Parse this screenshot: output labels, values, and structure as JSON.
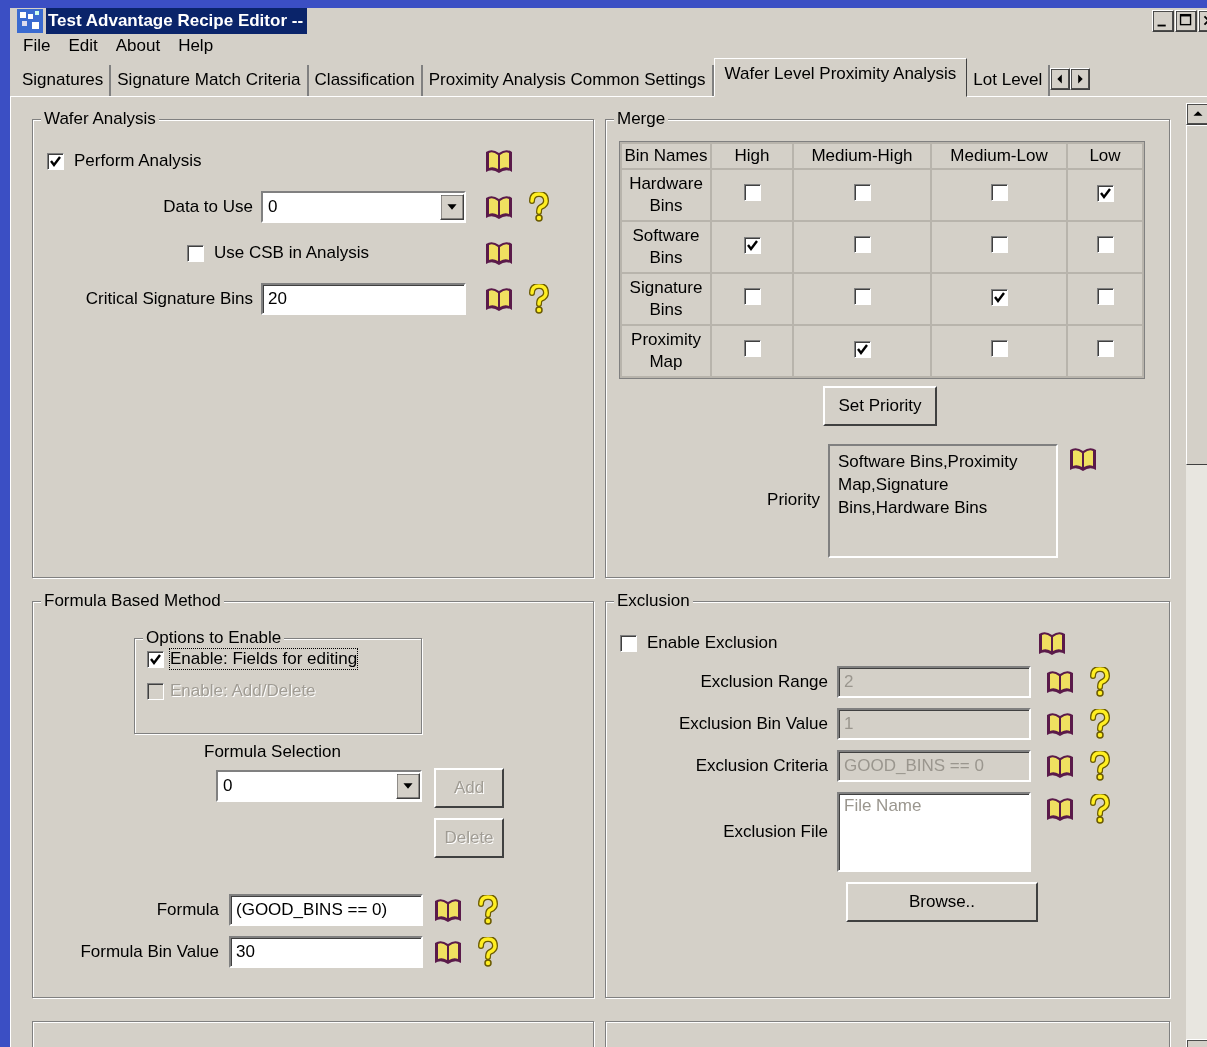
{
  "window": {
    "title": "Test Advantage Recipe Editor --"
  },
  "menu": [
    "File",
    "Edit",
    "About",
    "Help"
  ],
  "tabs": [
    {
      "label": "Signatures",
      "selected": false
    },
    {
      "label": "Signature Match Criteria",
      "selected": false
    },
    {
      "label": "Classification",
      "selected": false
    },
    {
      "label": "Proximity Analysis Common Settings",
      "selected": false
    },
    {
      "label": "Wafer Level Proximity Analysis",
      "selected": true
    },
    {
      "label": "Lot Level",
      "selected": false
    }
  ],
  "wafer_analysis": {
    "title": "Wafer Analysis",
    "rows": [
      {
        "kind": "checkbox",
        "label": "Perform Analysis",
        "checked": true,
        "help": false
      },
      {
        "kind": "dropdown",
        "label": "Data to Use",
        "value": "0",
        "help": true
      },
      {
        "kind": "checkbox",
        "label": "Use CSB in Analysis",
        "checked": false,
        "help": false
      },
      {
        "kind": "text",
        "label": "Critical Signature Bins",
        "value": "20",
        "help": true
      }
    ]
  },
  "merge": {
    "title": "Merge",
    "columns": [
      "Bin Names",
      "High",
      "Medium-High",
      "Medium-Low",
      "Low"
    ],
    "rows": [
      {
        "name": "Hardware Bins",
        "checks": [
          false,
          false,
          false,
          true
        ]
      },
      {
        "name": "Software Bins",
        "checks": [
          true,
          false,
          false,
          false
        ]
      },
      {
        "name": "Signature Bins",
        "checks": [
          false,
          false,
          true,
          false
        ]
      },
      {
        "name": "Proximity Map",
        "checks": [
          false,
          true,
          false,
          false
        ]
      }
    ],
    "button": "Set Priority",
    "priority_label": "Priority",
    "priority": "Software Bins,Proximity Map,Signature Bins,Hardware Bins"
  },
  "formula": {
    "title": "Formula Based Method",
    "options_title": "Options to Enable",
    "options": [
      {
        "label": "Enable: Fields for editing",
        "checked": true,
        "disabled": false,
        "focused": true
      },
      {
        "label": "Enable: Add/Delete",
        "checked": false,
        "disabled": true,
        "focused": false
      }
    ],
    "selection_label": "Formula Selection",
    "selection_value": "0",
    "buttons": [
      {
        "label": "Add",
        "disabled": true
      },
      {
        "label": "Delete",
        "disabled": true
      }
    ],
    "fields": [
      {
        "label": "Formula",
        "value": "(GOOD_BINS == 0)"
      },
      {
        "label": "Formula Bin Value",
        "value": "30"
      }
    ]
  },
  "exclusion": {
    "title": "Exclusion",
    "enable": {
      "label": "Enable Exclusion",
      "checked": false
    },
    "fields": [
      {
        "kind": "text",
        "label": "Exclusion Range",
        "value": "2",
        "disabled": true
      },
      {
        "kind": "text",
        "label": "Exclusion Bin Value",
        "value": "1",
        "disabled": true
      },
      {
        "kind": "text",
        "label": "Exclusion Criteria",
        "value": "GOOD_BINS == 0",
        "disabled": true
      },
      {
        "kind": "textarea",
        "label": "Exclusion File",
        "placeholder": "File Name",
        "disabled": false
      }
    ],
    "button": "Browse.."
  }
}
